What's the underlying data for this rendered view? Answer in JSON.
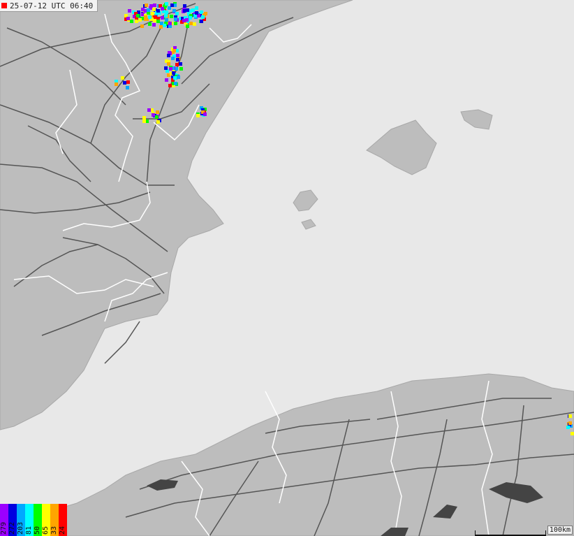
{
  "header": {
    "timestamp": "25-07-12 UTC 06:40",
    "live_color": "#ff0000"
  },
  "legend": {
    "segments": [
      {
        "label": "279",
        "color": "#9b00ff"
      },
      {
        "label": "272",
        "color": "#0000e0"
      },
      {
        "label": "203",
        "color": "#00a8ff"
      },
      {
        "label": "81",
        "color": "#00ffff"
      },
      {
        "label": "50",
        "color": "#00ff00"
      },
      {
        "label": "65",
        "color": "#ffff00"
      },
      {
        "label": "33",
        "color": "#ffa500"
      },
      {
        "label": "24",
        "color": "#ff0000"
      }
    ]
  },
  "scale": {
    "label": "100km"
  },
  "colors": {
    "sea": "#e8e8e8",
    "land": "#bdbdbd",
    "roads": "#555555",
    "borders": "#ffffff",
    "lakes": "#444444"
  }
}
